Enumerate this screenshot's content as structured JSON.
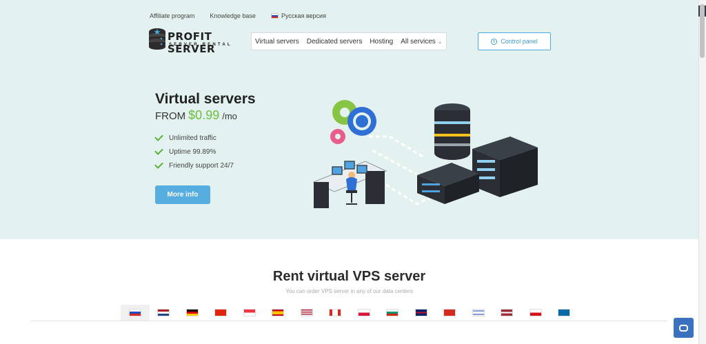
{
  "toplinks": {
    "affiliate": "Affiliate program",
    "knowledge": "Knowledge base",
    "russian": "Русская версия"
  },
  "logo": {
    "name": "PROFIT SERVER",
    "tagline": "SERVER RENTAL"
  },
  "nav": {
    "items": [
      "Virtual servers",
      "Dedicated servers",
      "Hosting"
    ],
    "all_services": "All services"
  },
  "control_panel": "Control panel",
  "hero": {
    "title": "Virtual servers",
    "price_prefix": "FROM",
    "price": "$0.99",
    "price_unit": "/mo",
    "features": [
      "Unlimited traffic",
      "Uptime 99.89%",
      "Friendly support 24/7"
    ],
    "cta": "More info"
  },
  "section": {
    "title": "Rent virtual VPS server",
    "subtitle": "You can order VPS server in any of our data centers"
  },
  "flags": [
    "russia-flag",
    "netherlands-flag",
    "germany-flag",
    "china-flag",
    "singapore-flag",
    "spain-flag",
    "usa-flag",
    "canada-flag",
    "poland-flag",
    "bulgaria-flag",
    "uk-flag",
    "switzerland-flag",
    "israel-flag",
    "latvia-flag",
    "czech-flag",
    "sweden-flag"
  ],
  "colors": {
    "hero_bg": "#e3f1f0",
    "accent_blue": "#55ade0",
    "price_green": "#6cbf3b",
    "check_green": "#58b33a",
    "chat_blue": "#3a72c0"
  }
}
